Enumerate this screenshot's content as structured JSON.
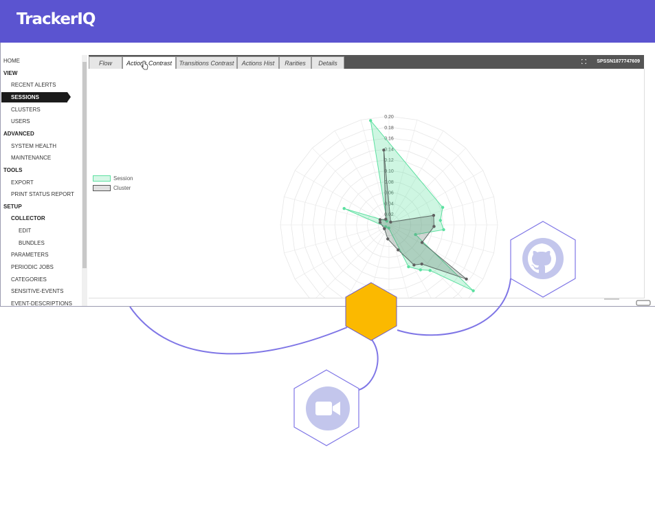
{
  "brand": {
    "logo_text": "TrackerIQ"
  },
  "sidebar": {
    "items": [
      {
        "label": "HOME",
        "level": 0,
        "head": false
      },
      {
        "label": "VIEW",
        "level": 0,
        "head": true
      },
      {
        "label": "RECENT ALERTS",
        "level": 1,
        "head": false
      },
      {
        "label": "SESSIONS",
        "level": 1,
        "head": false,
        "active": true
      },
      {
        "label": "CLUSTERS",
        "level": 1,
        "head": false
      },
      {
        "label": "USERS",
        "level": 1,
        "head": false
      },
      {
        "label": "ADVANCED",
        "level": 0,
        "head": true
      },
      {
        "label": "SYSTEM HEALTH",
        "level": 1,
        "head": false
      },
      {
        "label": "MAINTENANCE",
        "level": 1,
        "head": false
      },
      {
        "label": "TOOLS",
        "level": 0,
        "head": true
      },
      {
        "label": "EXPORT",
        "level": 1,
        "head": false
      },
      {
        "label": "PRINT STATUS REPORT",
        "level": 1,
        "head": false
      },
      {
        "label": "SETUP",
        "level": 0,
        "head": true
      },
      {
        "label": "COLLECTOR",
        "level": 1,
        "head": true
      },
      {
        "label": "EDIT",
        "level": 2,
        "head": false
      },
      {
        "label": "BUNDLES",
        "level": 2,
        "head": false
      },
      {
        "label": "PARAMETERS",
        "level": 1,
        "head": false
      },
      {
        "label": "PERIODIC JOBS",
        "level": 1,
        "head": false
      },
      {
        "label": "CATEGORIES",
        "level": 1,
        "head": false
      },
      {
        "label": "SENSITIVE-EVENTS",
        "level": 1,
        "head": false
      },
      {
        "label": "EVENT-DESCRIPTIONS",
        "level": 1,
        "head": false
      }
    ]
  },
  "tabs": [
    {
      "label": "Flow"
    },
    {
      "label": "Actions Contrast",
      "active": true
    },
    {
      "label": "Transitions Contrast"
    },
    {
      "label": "Actions Hist"
    },
    {
      "label": "Rarities"
    },
    {
      "label": "Details"
    }
  ],
  "session_id": "SPSSN1877747609",
  "legend": {
    "session": "Session",
    "cluster": "Cluster"
  },
  "colors": {
    "header": "#5b54d0",
    "session": "#5ce0a0",
    "cluster": "#707070",
    "hex_accent": "#fbb900",
    "hex_icon": "#c3c6ec"
  },
  "icons": {
    "github": "github-icon",
    "video": "video-camera-icon"
  },
  "chart_data": {
    "type": "radar",
    "rlim": [
      0,
      0.2
    ],
    "ticks": [
      "0.02",
      "0.04",
      "0.06",
      "0.08",
      "0.10",
      "0.12",
      "0.14",
      "0.16",
      "0.18",
      "0.20"
    ],
    "series": [
      {
        "name": "Session",
        "points": [
          {
            "angle": -10,
            "r": 0.195
          },
          {
            "angle": 72,
            "r": 0.104
          },
          {
            "angle": 85,
            "r": 0.095
          },
          {
            "angle": 95,
            "r": 0.101
          },
          {
            "angle": 110,
            "r": 0.052
          },
          {
            "angle": 128,
            "r": 0.197
          },
          {
            "angle": 138,
            "r": 0.113
          },
          {
            "angle": 145,
            "r": 0.101
          },
          {
            "angle": 155,
            "r": 0.085
          },
          {
            "angle": 185,
            "r": 0.006
          },
          {
            "angle": 240,
            "r": 0.007
          },
          {
            "angle": 290,
            "r": 0.088
          },
          {
            "angle": 330,
            "r": 0.008
          }
        ]
      },
      {
        "name": "Cluster",
        "points": [
          {
            "angle": -4,
            "r": 0.138
          },
          {
            "angle": 30,
            "r": 0.006
          },
          {
            "angle": 78,
            "r": 0.084
          },
          {
            "angle": 92,
            "r": 0.083
          },
          {
            "angle": 118,
            "r": 0.069
          },
          {
            "angle": 125,
            "r": 0.174
          },
          {
            "angle": 140,
            "r": 0.094
          },
          {
            "angle": 148,
            "r": 0.087
          },
          {
            "angle": 160,
            "r": 0.049
          },
          {
            "angle": 185,
            "r": 0.026
          },
          {
            "angle": 230,
            "r": 0.011
          },
          {
            "angle": 285,
            "r": 0.017
          },
          {
            "angle": 300,
            "r": 0.019
          },
          {
            "angle": 330,
            "r": 0.012
          }
        ]
      }
    ]
  }
}
